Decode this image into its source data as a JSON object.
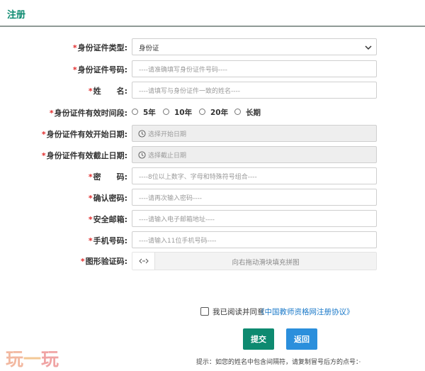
{
  "header": {
    "title": "注册"
  },
  "form": {
    "id_type": {
      "label": "身份证件类型:",
      "value": "身份证"
    },
    "id_number": {
      "label": "身份证件号码:",
      "placeholder": "----请准确填写身份证件号码----"
    },
    "name": {
      "label": "姓　　名:",
      "placeholder": "----请填写与身份证件一致的姓名----"
    },
    "validity": {
      "label": "身份证件有效时间段:",
      "options": [
        {
          "label": "5年"
        },
        {
          "label": "10年"
        },
        {
          "label": "20年"
        },
        {
          "label": "长期"
        }
      ]
    },
    "start_date": {
      "label": "身份证件有效开始日期:",
      "placeholder": "选择开始日期"
    },
    "end_date": {
      "label": "身份证件有效截止日期:",
      "placeholder": "选择截止日期"
    },
    "password": {
      "label": "密　　码:",
      "placeholder": "----8位以上数字、字母和特殊符号组合----"
    },
    "confirm_password": {
      "label": "确认密码:",
      "placeholder": "----请再次输入密码----"
    },
    "email": {
      "label": "安全邮箱:",
      "placeholder": "----请输入电子邮箱地址----"
    },
    "phone": {
      "label": "手机号码:",
      "placeholder": "----请输入11位手机号码----"
    },
    "captcha": {
      "label": "图形验证码:",
      "slider_text": "向右拖动滑块填充拼图"
    }
  },
  "required_mark": "*",
  "agreement": {
    "text": "我已阅读并同意",
    "link": "《中国教师资格网注册协议》"
  },
  "buttons": {
    "submit": "提交",
    "back": "返回"
  },
  "hint": "提示：如您的姓名中包含间隔符，请复制冒号后方的点号：·",
  "watermark": {
    "c1": "玩",
    "c2": "一",
    "c3": "玩"
  },
  "colors": {
    "brand": "#0b8a6f",
    "submit": "#0e8a70",
    "back": "#2b8fdc",
    "link": "#1a79c9",
    "required": "#e02b2b"
  }
}
